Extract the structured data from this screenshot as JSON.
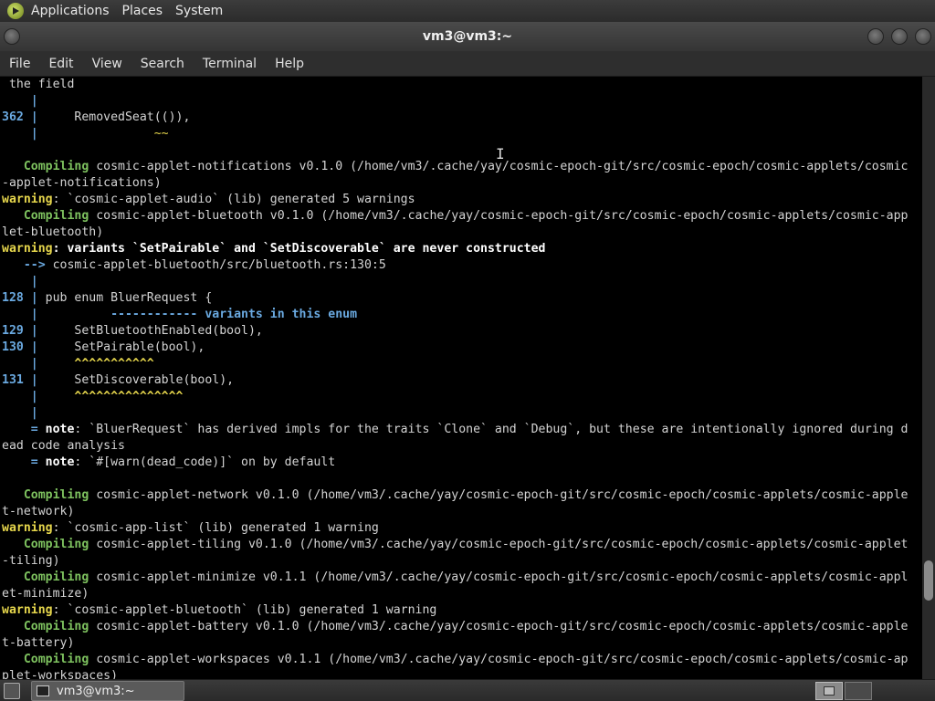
{
  "top_panel": {
    "menus": [
      "Applications",
      "Places",
      "System"
    ]
  },
  "window": {
    "title": "vm3@vm3:~"
  },
  "menubar": {
    "items": [
      "File",
      "Edit",
      "View",
      "Search",
      "Terminal",
      "Help"
    ]
  },
  "terminal": {
    "lines": [
      [
        {
          "t": " the field",
          "c": ""
        }
      ],
      [
        {
          "t": "    |",
          "c": "blue b"
        }
      ],
      [
        {
          "t": "362 |",
          "c": "blue b"
        },
        {
          "t": "     RemovedSeat(()),",
          "c": ""
        }
      ],
      [
        {
          "t": "    |",
          "c": "blue b"
        },
        {
          "t": "                ~~",
          "c": "yellow"
        }
      ],
      [
        {
          "t": "",
          "c": ""
        }
      ],
      [
        {
          "t": "   Compiling",
          "c": "green b"
        },
        {
          "t": " cosmic-applet-notifications v0.1.0 (/home/vm3/.cache/yay/cosmic-epoch-git/src/cosmic-epoch/cosmic-applets/cosmic",
          "c": ""
        }
      ],
      [
        {
          "t": "-applet-notifications)",
          "c": ""
        }
      ],
      [
        {
          "t": "warning",
          "c": "yellow b"
        },
        {
          "t": ": `cosmic-applet-audio` (lib) generated 5 warnings",
          "c": ""
        }
      ],
      [
        {
          "t": "   Compiling",
          "c": "green b"
        },
        {
          "t": " cosmic-applet-bluetooth v0.1.0 (/home/vm3/.cache/yay/cosmic-epoch-git/src/cosmic-epoch/cosmic-applets/cosmic-app",
          "c": ""
        }
      ],
      [
        {
          "t": "let-bluetooth)",
          "c": ""
        }
      ],
      [
        {
          "t": "warning",
          "c": "yellow b"
        },
        {
          "t": ": variants `SetPairable` and `SetDiscoverable` are never constructed",
          "c": "white b"
        }
      ],
      [
        {
          "t": "   -->",
          "c": "blue b"
        },
        {
          "t": " cosmic-applet-bluetooth/src/bluetooth.rs:130:5",
          "c": ""
        }
      ],
      [
        {
          "t": "    |",
          "c": "blue b"
        }
      ],
      [
        {
          "t": "128 |",
          "c": "blue b"
        },
        {
          "t": " pub enum BluerRequest {",
          "c": ""
        }
      ],
      [
        {
          "t": "    |",
          "c": "blue b"
        },
        {
          "t": "          ------------ variants in this enum",
          "c": "blue b"
        }
      ],
      [
        {
          "t": "129 |",
          "c": "blue b"
        },
        {
          "t": "     SetBluetoothEnabled(bool),",
          "c": ""
        }
      ],
      [
        {
          "t": "130 |",
          "c": "blue b"
        },
        {
          "t": "     SetPairable(bool),",
          "c": ""
        }
      ],
      [
        {
          "t": "    |",
          "c": "blue b"
        },
        {
          "t": "     ^^^^^^^^^^^",
          "c": "yellow b"
        }
      ],
      [
        {
          "t": "131 |",
          "c": "blue b"
        },
        {
          "t": "     SetDiscoverable(bool),",
          "c": ""
        }
      ],
      [
        {
          "t": "    |",
          "c": "blue b"
        },
        {
          "t": "     ^^^^^^^^^^^^^^^",
          "c": "yellow b"
        }
      ],
      [
        {
          "t": "    |",
          "c": "blue b"
        }
      ],
      [
        {
          "t": "    =",
          "c": "blue b"
        },
        {
          "t": " note",
          "c": "white b"
        },
        {
          "t": ": `BluerRequest` has derived impls for the traits `Clone` and `Debug`, but these are intentionally ignored during d",
          "c": ""
        }
      ],
      [
        {
          "t": "ead code analysis",
          "c": ""
        }
      ],
      [
        {
          "t": "    =",
          "c": "blue b"
        },
        {
          "t": " note",
          "c": "white b"
        },
        {
          "t": ": `#[warn(dead_code)]` on by default",
          "c": ""
        }
      ],
      [
        {
          "t": "",
          "c": ""
        }
      ],
      [
        {
          "t": "   Compiling",
          "c": "green b"
        },
        {
          "t": " cosmic-applet-network v0.1.0 (/home/vm3/.cache/yay/cosmic-epoch-git/src/cosmic-epoch/cosmic-applets/cosmic-apple",
          "c": ""
        }
      ],
      [
        {
          "t": "t-network)",
          "c": ""
        }
      ],
      [
        {
          "t": "warning",
          "c": "yellow b"
        },
        {
          "t": ": `cosmic-app-list` (lib) generated 1 warning",
          "c": ""
        }
      ],
      [
        {
          "t": "   Compiling",
          "c": "green b"
        },
        {
          "t": " cosmic-applet-tiling v0.1.0 (/home/vm3/.cache/yay/cosmic-epoch-git/src/cosmic-epoch/cosmic-applets/cosmic-applet",
          "c": ""
        }
      ],
      [
        {
          "t": "-tiling)",
          "c": ""
        }
      ],
      [
        {
          "t": "   Compiling",
          "c": "green b"
        },
        {
          "t": " cosmic-applet-minimize v0.1.1 (/home/vm3/.cache/yay/cosmic-epoch-git/src/cosmic-epoch/cosmic-applets/cosmic-appl",
          "c": ""
        }
      ],
      [
        {
          "t": "et-minimize)",
          "c": ""
        }
      ],
      [
        {
          "t": "warning",
          "c": "yellow b"
        },
        {
          "t": ": `cosmic-applet-bluetooth` (lib) generated 1 warning",
          "c": ""
        }
      ],
      [
        {
          "t": "   Compiling",
          "c": "green b"
        },
        {
          "t": " cosmic-applet-battery v0.1.0 (/home/vm3/.cache/yay/cosmic-epoch-git/src/cosmic-epoch/cosmic-applets/cosmic-apple",
          "c": ""
        }
      ],
      [
        {
          "t": "t-battery)",
          "c": ""
        }
      ],
      [
        {
          "t": "   Compiling",
          "c": "green b"
        },
        {
          "t": " cosmic-applet-workspaces v0.1.1 (/home/vm3/.cache/yay/cosmic-epoch-git/src/cosmic-epoch/cosmic-applets/cosmic-ap",
          "c": ""
        }
      ],
      [
        {
          "t": "plet-workspaces)",
          "c": ""
        }
      ]
    ]
  },
  "taskbar": {
    "task_label": "vm3@vm3:~"
  }
}
